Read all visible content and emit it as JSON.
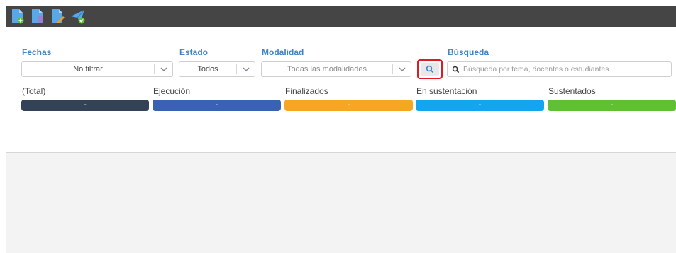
{
  "toolbar": {
    "buttons": [
      {
        "name": "new-document-icon",
        "color": "#5aa7e8",
        "badge": "#5fbf3b"
      },
      {
        "name": "document-stack-icon",
        "color": "#5aa7e8",
        "badge": "#9a7fd6"
      },
      {
        "name": "edit-document-icon",
        "color": "#5aa7e8",
        "badge": "#f0a020"
      },
      {
        "name": "send-check-icon",
        "color": "#5aa7e8",
        "badge": "#5fbf3b"
      }
    ]
  },
  "filters": {
    "fechas": {
      "label": "Fechas",
      "value": "No filtrar"
    },
    "estado": {
      "label": "Estado",
      "value": "Todos"
    },
    "modalidad": {
      "label": "Modalidad",
      "value": "Todas las modalidades"
    },
    "busqueda": {
      "label": "Búsqueda",
      "placeholder": "Búsqueda por tema, docentes o estudiantes"
    }
  },
  "stats": [
    {
      "label": "(Total)",
      "value": "-",
      "color": "#344257"
    },
    {
      "label": "Ejecución",
      "value": "-",
      "color": "#3a62b3"
    },
    {
      "label": "Finalizados",
      "value": "-",
      "color": "#f5a623"
    },
    {
      "label": "En sustentación",
      "value": "-",
      "color": "#13a6ee"
    },
    {
      "label": "Sustentados",
      "value": "-",
      "color": "#5ec032"
    }
  ]
}
